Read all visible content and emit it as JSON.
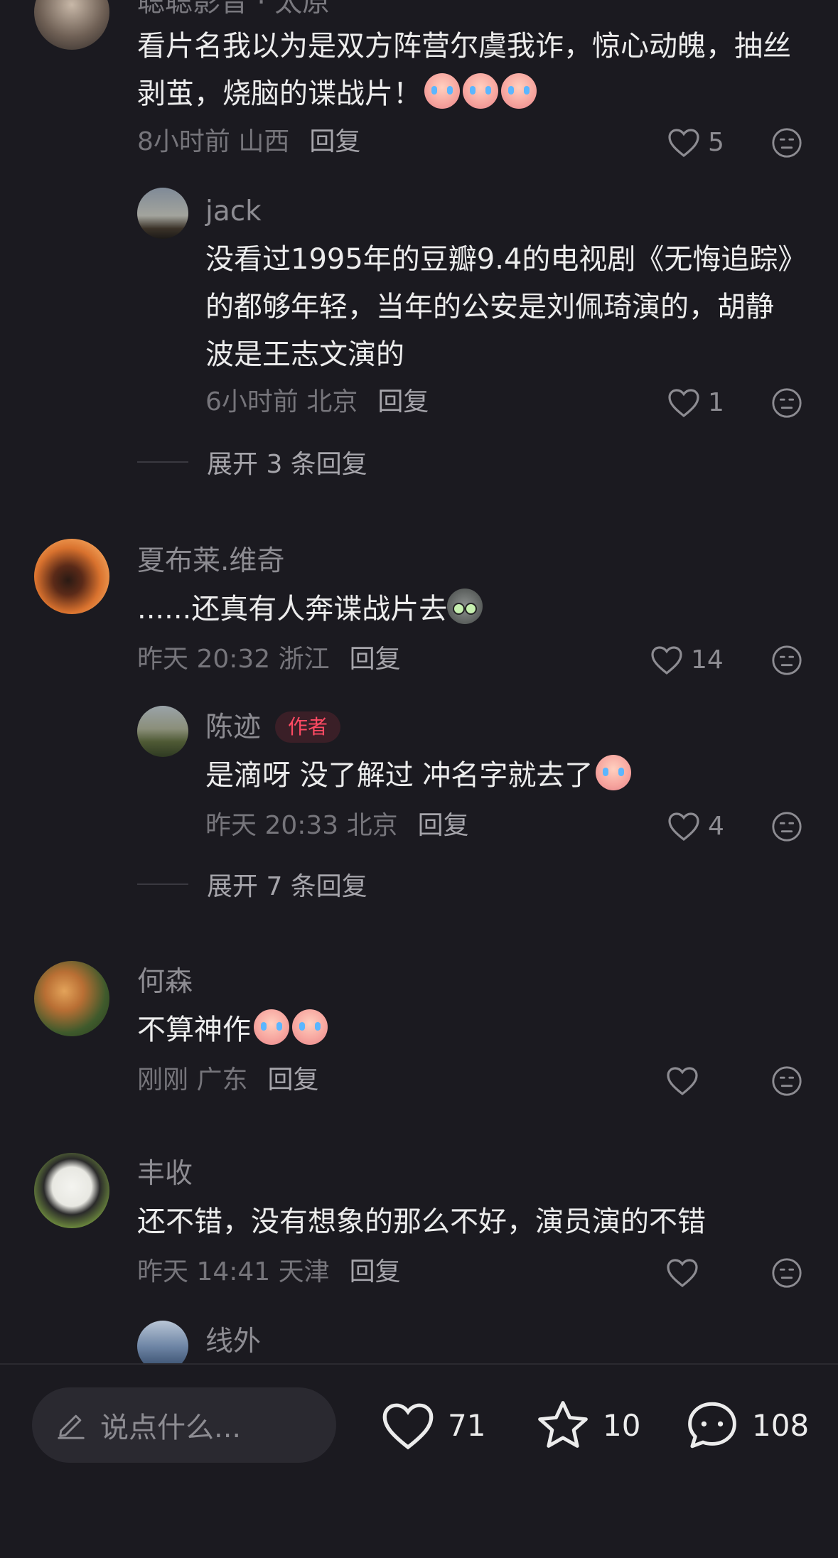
{
  "comments": [
    {
      "user": "聪聪影音 · 太原",
      "text": "看片名我以为是双方阵营尔虞我诈，惊心动魄，抽丝剥茧，烧脑的谍战片！",
      "time": "8小时前",
      "location": "山西",
      "reply_label": "回复",
      "likes": "5",
      "emoji": "crying-laugh-emoji x3"
    },
    {
      "user": "jack",
      "text": "没看过1995年的豆瓣9.4的电视剧《无悔追踪》的都够年轻，当年的公安是刘佩琦演的，胡静波是王志文演的",
      "time": "6小时前",
      "location": "北京",
      "reply_label": "回复",
      "likes": "1",
      "expand_label": "展开 3 条回复"
    },
    {
      "user": "夏布莱.维奇",
      "text": "......还真有人奔谍战片去",
      "time": "昨天 20:32",
      "location": "浙江",
      "reply_label": "回复",
      "likes": "14"
    },
    {
      "user": "陈迹",
      "badge": "作者",
      "text": "是滴呀 没了解过 冲名字就去了",
      "time": "昨天 20:33",
      "location": "北京",
      "reply_label": "回复",
      "likes": "4",
      "expand_label": "展开 7 条回复"
    },
    {
      "user": "何森",
      "text": "不算神作",
      "time": "刚刚",
      "location": "广东",
      "reply_label": "回复",
      "likes": ""
    },
    {
      "user": "丰收",
      "text": "还不错，没有想象的那么不好，演员演的不错",
      "time": "昨天 14:41",
      "location": "天津",
      "reply_label": "回复",
      "likes": ""
    },
    {
      "user": "线外"
    }
  ],
  "bottom_bar": {
    "input_placeholder": "说点什么...",
    "likes": "71",
    "favorites": "10",
    "comments": "108"
  },
  "colors": {
    "background": "#1b1a20",
    "author_badge": "#ff4a63"
  }
}
